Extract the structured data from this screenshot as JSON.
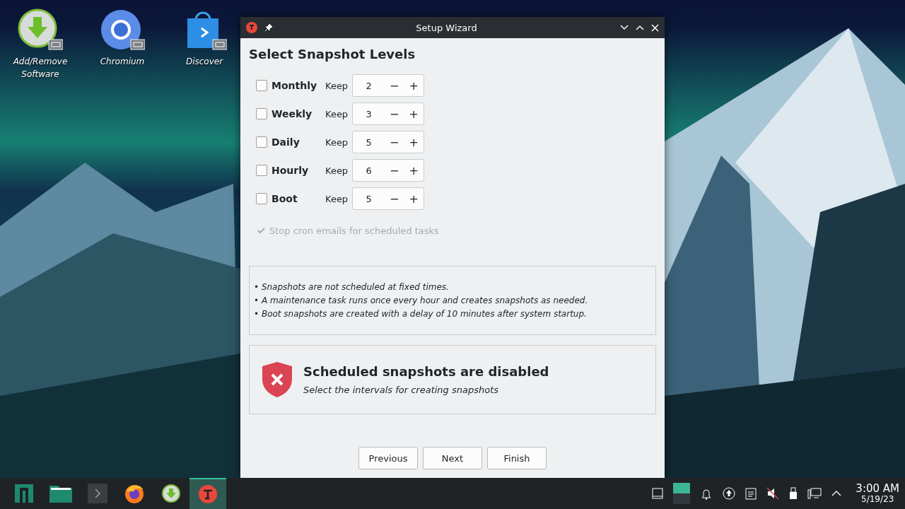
{
  "desktop_icons": [
    {
      "label": "Add/Remove Software",
      "kind": "install"
    },
    {
      "label": "Chromium",
      "kind": "browser"
    },
    {
      "label": "Discover",
      "kind": "store"
    }
  ],
  "window": {
    "title": "Setup Wizard",
    "heading": "Select Snapshot Levels",
    "levels": [
      {
        "label": "Monthly",
        "checked": false,
        "keep_label": "Keep",
        "value": "2",
        "minus": "−",
        "plus": "+"
      },
      {
        "label": "Weekly",
        "checked": false,
        "keep_label": "Keep",
        "value": "3",
        "minus": "−",
        "plus": "+"
      },
      {
        "label": "Daily",
        "checked": false,
        "keep_label": "Keep",
        "value": "5",
        "minus": "−",
        "plus": "+"
      },
      {
        "label": "Hourly",
        "checked": false,
        "keep_label": "Keep",
        "value": "6",
        "minus": "−",
        "plus": "+"
      },
      {
        "label": "Boot",
        "checked": false,
        "keep_label": "Keep",
        "value": "5",
        "minus": "−",
        "plus": "+"
      }
    ],
    "stop_cron": {
      "label": "Stop cron emails for scheduled tasks",
      "checked": true,
      "disabled": true
    },
    "notes": [
      "• Snapshots are not scheduled at fixed times.",
      "• A maintenance task runs once every hour and creates snapshots as needed.",
      "• Boot snapshots are created with a delay of 10 minutes after system startup."
    ],
    "status": {
      "title": "Scheduled snapshots are disabled",
      "subtitle": "Select the intervals for creating snapshots"
    },
    "buttons": [
      "Previous",
      "Next",
      "Finish"
    ]
  },
  "taskbar": {
    "apps": [
      {
        "kind": "menu",
        "active": false
      },
      {
        "kind": "files",
        "active": false
      },
      {
        "kind": "terminal",
        "active": false
      },
      {
        "kind": "firefox",
        "active": false
      },
      {
        "kind": "install",
        "active": false
      },
      {
        "kind": "timeshift",
        "active": true
      }
    ],
    "time": "3:00 AM",
    "date": "5/19/23"
  }
}
